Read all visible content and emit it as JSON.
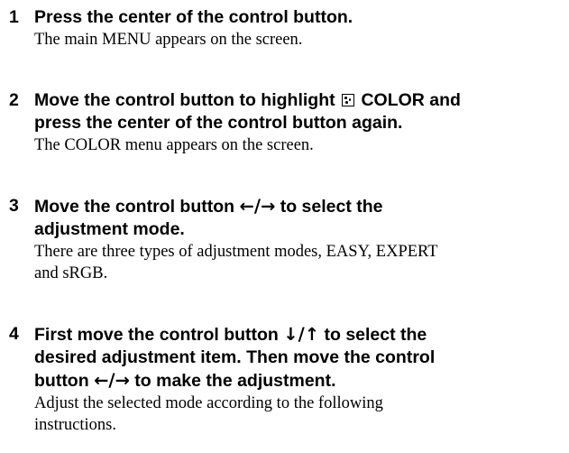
{
  "steps": [
    {
      "number": "1",
      "title_lines": [
        "Press the center of the control button."
      ],
      "description_lines": [
        "The main MENU appears on the screen."
      ]
    },
    {
      "number": "2",
      "title_line1_before_icon": "Move the control button to highlight",
      "title_line1_after_icon": "COLOR and",
      "title_icon": "color-menu-icon",
      "title_line2": "press the center of the control button again.",
      "description_lines": [
        "The COLOR menu appears on the screen."
      ]
    },
    {
      "number": "3",
      "title_line1_before_arrows": "Move the control button",
      "title_line1_arrows": "←/→",
      "title_line1_after_arrows": "to select the",
      "title_line2": "adjustment mode.",
      "description_lines": [
        "There are three types of adjustment modes, EASY, EXPERT",
        "and sRGB."
      ]
    },
    {
      "number": "4",
      "title_line1_before_arrows": "First move the control button",
      "title_line1_arrows": "↓/↑",
      "title_line1_after_arrows": "to select the",
      "title_line2": "desired adjustment item. Then move the control",
      "title_line3_before_arrows": "button",
      "title_line3_arrows": "←/→",
      "title_line3_after_arrows": "to make the adjustment.",
      "description_lines": [
        "Adjust the selected mode according to the following",
        "instructions."
      ]
    }
  ]
}
